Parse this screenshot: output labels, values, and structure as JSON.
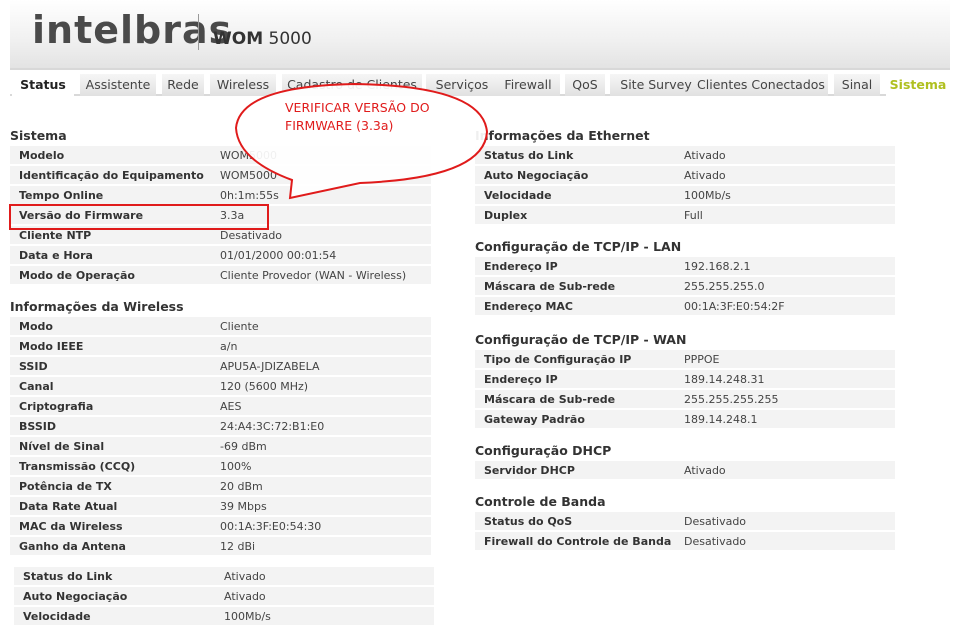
{
  "header": {
    "logo": "intelbras",
    "product_name": "WOM",
    "product_model": "5000"
  },
  "tabs": [
    {
      "label": "Status",
      "state": "active"
    },
    {
      "label": "Assistente"
    },
    {
      "label": "Rede"
    },
    {
      "label": "Wireless"
    },
    {
      "label": "Cadastro de Clientes"
    },
    {
      "label": "Serviços"
    },
    {
      "label": "Firewall"
    },
    {
      "label": "QoS"
    },
    {
      "label": "Site Survey"
    },
    {
      "label": "Clientes Conectados"
    },
    {
      "label": "Sinal"
    },
    {
      "label": "Sistema",
      "state": "highlight"
    }
  ],
  "sistema": {
    "title": "Sistema",
    "rows": [
      {
        "label": "Modelo",
        "value": "WOM5000"
      },
      {
        "label": "Identificação do Equipamento",
        "value": "WOM5000"
      },
      {
        "label": "Tempo Online",
        "value": "0h:1m:55s"
      },
      {
        "label": "Versão do Firmware",
        "value": "3.3a"
      },
      {
        "label": "Cliente NTP",
        "value": "Desativado"
      },
      {
        "label": "Data e Hora",
        "value": "01/01/2000 00:01:54"
      },
      {
        "label": "Modo de Operação",
        "value": "Cliente Provedor (WAN - Wireless)"
      }
    ]
  },
  "wireless": {
    "title": "Informações da Wireless",
    "rows": [
      {
        "label": "Modo",
        "value": "Cliente"
      },
      {
        "label": "Modo IEEE",
        "value": "a/n"
      },
      {
        "label": "SSID",
        "value": "APU5A-JDIZABELA"
      },
      {
        "label": "Canal",
        "value": "120 (5600 MHz)"
      },
      {
        "label": "Criptografia",
        "value": "AES"
      },
      {
        "label": "BSSID",
        "value": "24:A4:3C:72:B1:E0"
      },
      {
        "label": "Nível de Sinal",
        "value": "-69 dBm"
      },
      {
        "label": "Transmissão (CCQ)",
        "value": "100%"
      },
      {
        "label": "Potência de TX",
        "value": "20 dBm"
      },
      {
        "label": "Data Rate Atual",
        "value": "39 Mbps"
      },
      {
        "label": "MAC da Wireless",
        "value": "00:1A:3F:E0:54:30"
      },
      {
        "label": "Ganho da Antena",
        "value": "12 dBi"
      }
    ]
  },
  "extra_rows": [
    {
      "label": "Status do Link",
      "value": "Ativado"
    },
    {
      "label": "Auto Negociação",
      "value": "Ativado"
    },
    {
      "label": "Velocidade",
      "value": "100Mb/s"
    }
  ],
  "ethernet": {
    "title": "Informações da Ethernet",
    "rows": [
      {
        "label": "Status do Link",
        "value": "Ativado"
      },
      {
        "label": "Auto Negociação",
        "value": "Ativado"
      },
      {
        "label": "Velocidade",
        "value": "100Mb/s"
      },
      {
        "label": "Duplex",
        "value": "Full"
      }
    ]
  },
  "tcpip_lan": {
    "title": "Configuração de TCP/IP - LAN",
    "rows": [
      {
        "label": "Endereço IP",
        "value": "192.168.2.1"
      },
      {
        "label": "Máscara de Sub-rede",
        "value": "255.255.255.0"
      },
      {
        "label": "Endereço MAC",
        "value": "00:1A:3F:E0:54:2F"
      }
    ]
  },
  "tcpip_wan": {
    "title": "Configuração de TCP/IP - WAN",
    "rows": [
      {
        "label": "Tipo de Configuração IP",
        "value": "PPPOE"
      },
      {
        "label": "Endereço IP",
        "value": "189.14.248.31"
      },
      {
        "label": "Máscara de Sub-rede",
        "value": "255.255.255.255"
      },
      {
        "label": "Gateway Padrão",
        "value": "189.14.248.1"
      }
    ]
  },
  "dhcp": {
    "title": "Configuração DHCP",
    "rows": [
      {
        "label": "Servidor DHCP",
        "value": "Ativado"
      }
    ]
  },
  "banda": {
    "title": "Controle de Banda",
    "rows": [
      {
        "label": "Status do QoS",
        "value": "Desativado"
      },
      {
        "label": "Firewall do Controle de Banda",
        "value": "Desativado"
      }
    ]
  },
  "annotation": {
    "line1": "VERIFICAR VERSÃO DO",
    "line2": "FIRMWARE (3.3a)",
    "color": "#e01b1b"
  }
}
